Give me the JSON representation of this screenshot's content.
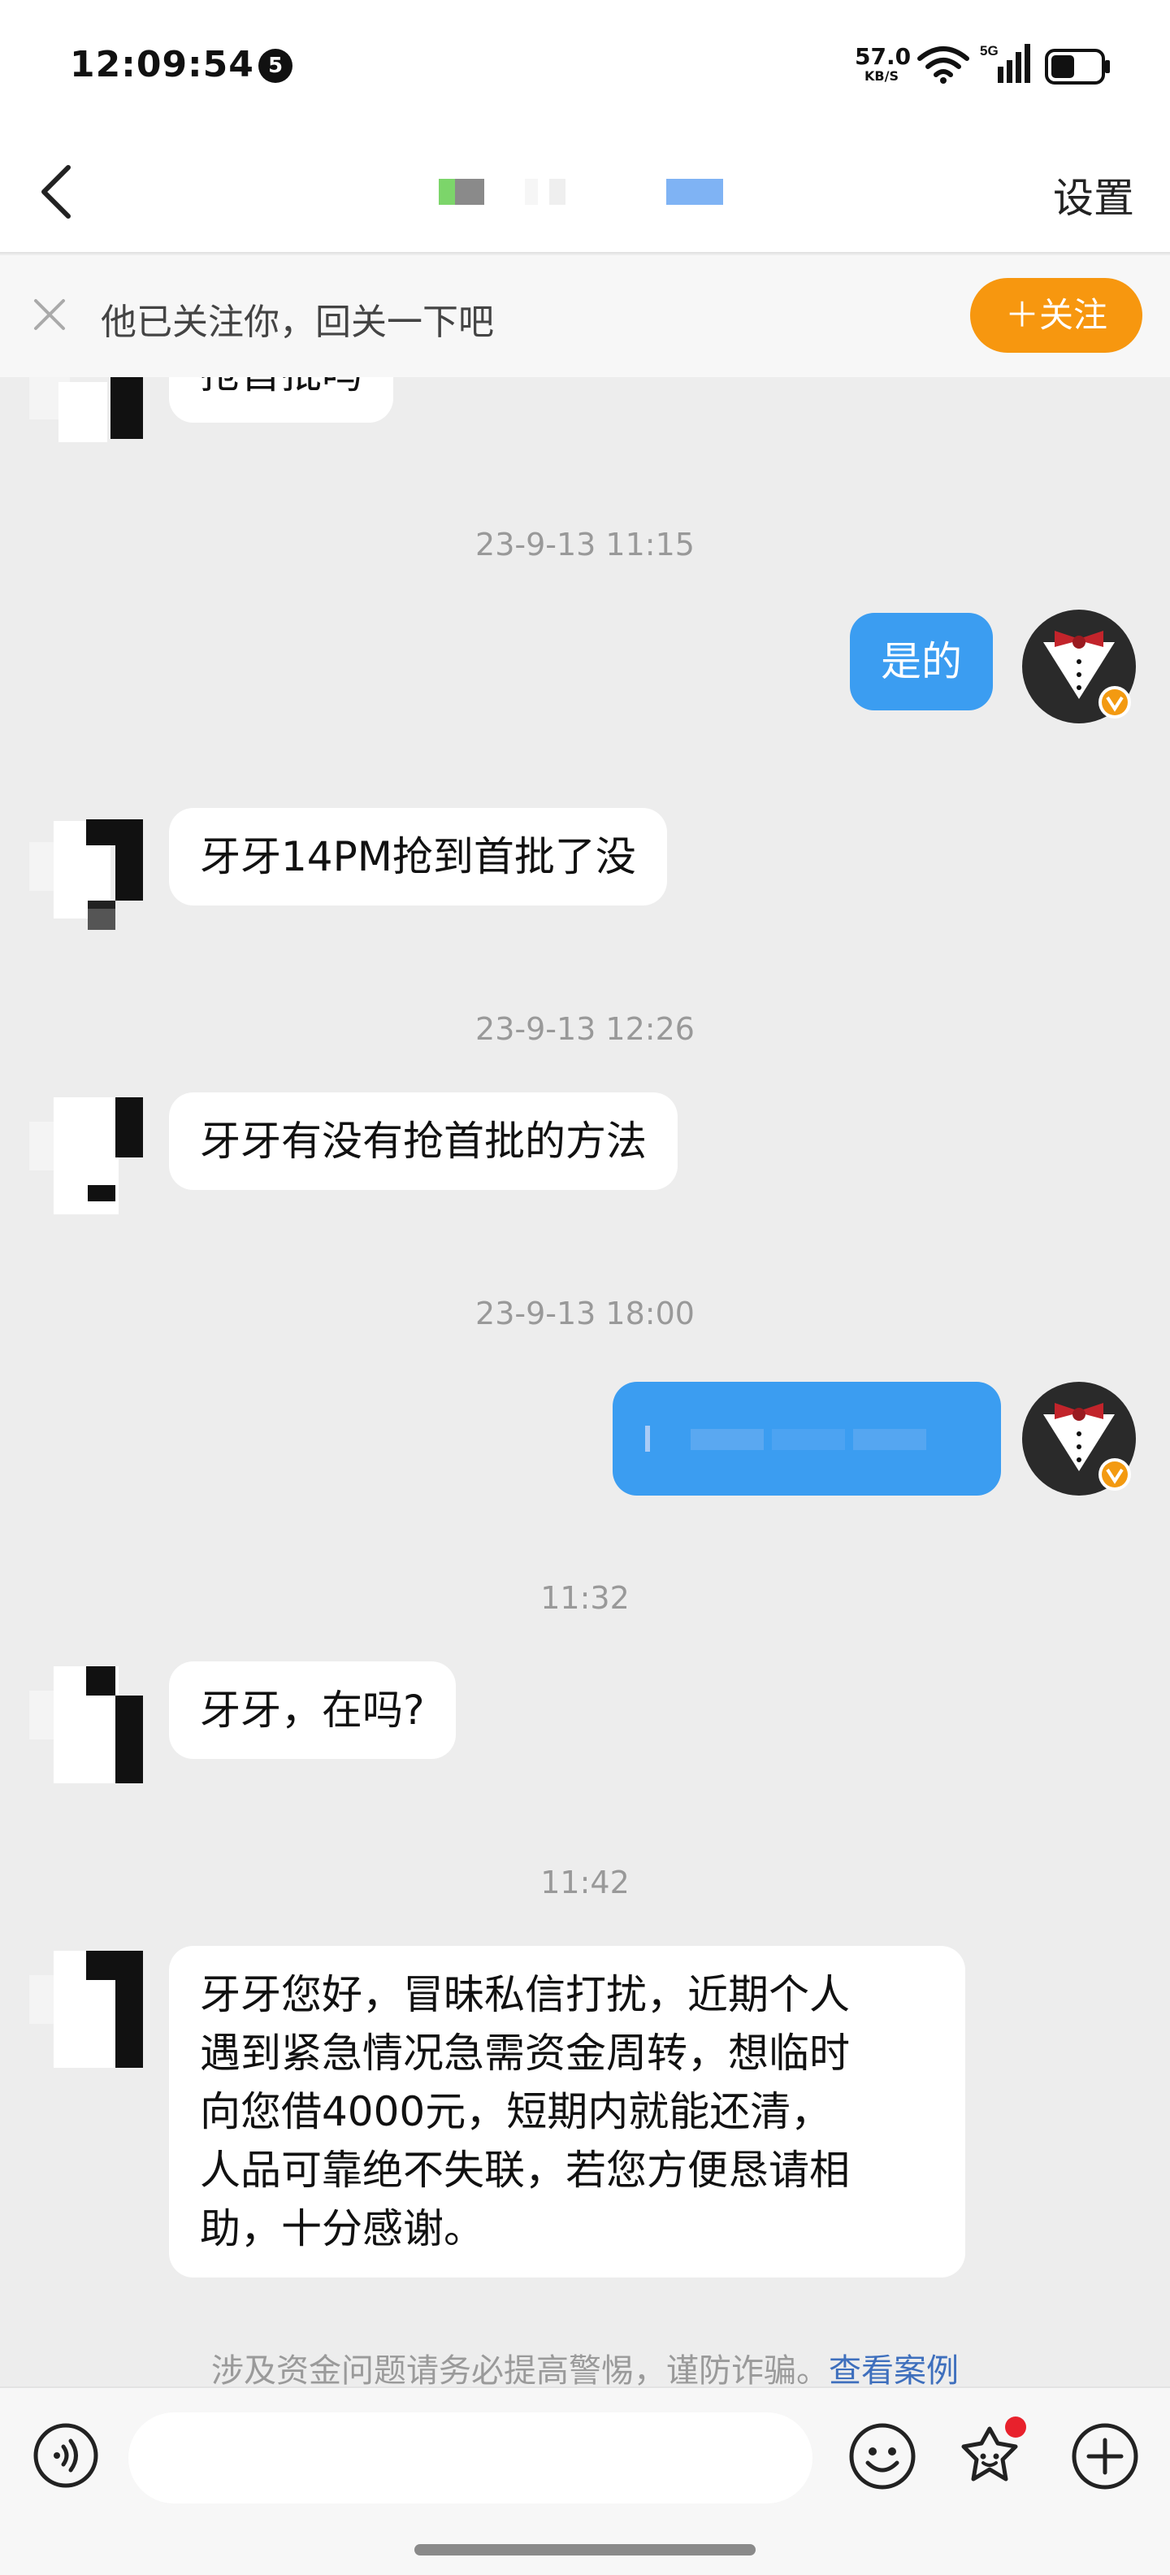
{
  "status_bar": {
    "time": "12:09:54",
    "notification_count": "5",
    "net_speed_value": "57.0",
    "net_speed_unit": "KB/S",
    "network_type": "5G"
  },
  "header": {
    "back_icon": "chevron-left-icon",
    "settings_label": "设置"
  },
  "follow_banner": {
    "text": "他已关注你，回关一下吧",
    "follow_button_label": "＋关注"
  },
  "messages": [
    {
      "type": "incoming",
      "text": "抢首批吗"
    },
    {
      "type": "timestamp",
      "text": "23-9-13 11:15"
    },
    {
      "type": "outgoing",
      "text": "是的"
    },
    {
      "type": "incoming",
      "text": "牙牙14PM抢到首批了没"
    },
    {
      "type": "timestamp",
      "text": "23-9-13 12:26"
    },
    {
      "type": "incoming",
      "text": "牙牙有没有抢首批的方法"
    },
    {
      "type": "timestamp",
      "text": "23-9-13 18:00"
    },
    {
      "type": "outgoing",
      "text": ""
    },
    {
      "type": "timestamp",
      "text": "11:32"
    },
    {
      "type": "incoming",
      "text": "牙牙，在吗?"
    },
    {
      "type": "timestamp",
      "text": "11:42"
    },
    {
      "type": "incoming",
      "text_lines": [
        "牙牙您好，冒昧私信打扰，近期个人",
        "遇到紧急情况急需资金周转，想临时",
        "向您借4000元，短期内就能还清，",
        "人品可靠绝不失联，若您方便恳请相",
        "助，十分感谢。"
      ]
    }
  ],
  "warning": {
    "text": "涉及资金问题请务必提高警惕，谨防诈骗。",
    "link_label": "查看案例"
  },
  "input_bar": {
    "input_value": "",
    "voice_icon": "voice-icon",
    "emoji_icon": "emoji-icon",
    "sticker_icon": "sticker-icon",
    "plus_icon": "plus-icon"
  },
  "colors": {
    "outgoing_bubble": "#3b9df1",
    "follow_button": "#f7970f",
    "link": "#3e6fbd",
    "badge_dot": "#e8212c"
  }
}
